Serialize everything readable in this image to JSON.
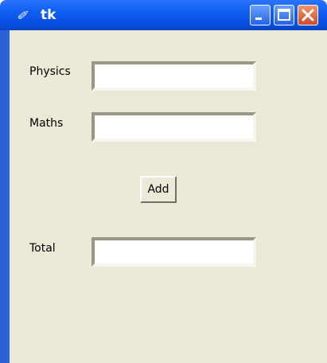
{
  "window": {
    "title": "tk",
    "icon": "feather-icon",
    "controls": [
      "minimize-icon",
      "maximize-icon",
      "close-icon"
    ]
  },
  "form": {
    "fields": [
      {
        "label": "Physics",
        "value": ""
      },
      {
        "label": "Maths",
        "value": ""
      }
    ],
    "add_button": "Add",
    "total": {
      "label": "Total",
      "value": ""
    }
  },
  "colors": {
    "titlebar": "#0a52e6",
    "client_bg": "#ece9d8",
    "close_button": "#d24a25"
  }
}
